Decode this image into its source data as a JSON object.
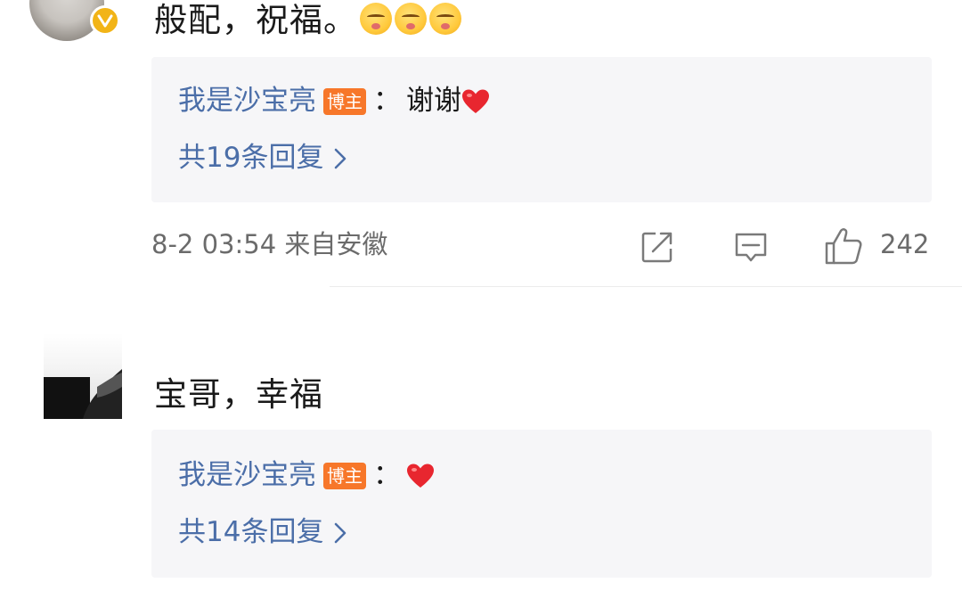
{
  "comments": [
    {
      "text": "般配，祝福。",
      "emojis": [
        "flushed-emoji",
        "flushed-emoji",
        "flushed-emoji"
      ],
      "verified_badge": "v-icon",
      "reply": {
        "author": "我是沙宝亮",
        "badge": "博主",
        "separator": "：",
        "text": "谢谢",
        "has_heart": true,
        "more": "共19条回复"
      },
      "meta": "8-2 03:54  来自安徽",
      "like_count": "242"
    },
    {
      "text": "宝哥，幸福",
      "reply": {
        "author": "我是沙宝亮",
        "badge": "博主",
        "separator": "：",
        "text": "",
        "has_heart": true,
        "more": "共14条回复"
      }
    }
  ],
  "colors": {
    "link_blue": "#4b6ea8",
    "badge_orange": "#f7772a",
    "verified_gold": "#f2b417",
    "reply_bg": "#f6f6f8",
    "heart_red": "#e8262f"
  }
}
